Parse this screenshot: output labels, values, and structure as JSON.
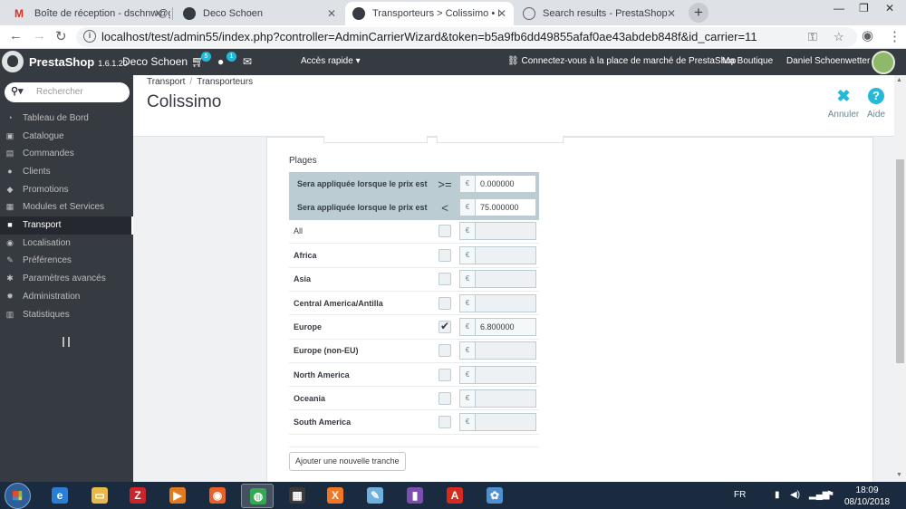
{
  "browser": {
    "tabs": [
      {
        "title": "Boîte de réception - dschnw@gm",
        "favicon_color": "#d93025"
      },
      {
        "title": "Deco Schoen",
        "favicon_color": "#363a41"
      },
      {
        "title": "Transporteurs > Colissimo • Deco",
        "favicon_color": "#363a41"
      },
      {
        "title": "Search results - PrestaShop",
        "favicon_color": "#5f6368"
      }
    ],
    "new_tab": "+",
    "url": "localhost/test/admin55/index.php?controller=AdminCarrierWizard&token=b5a9fb6dd49855afaf0ae43abdeb848f&id_carrier=11"
  },
  "header": {
    "brand": "PrestaShop",
    "version": "1.6.1.20",
    "shop_name": "Deco Schoen",
    "orders_badge": "5",
    "customers_badge": "1",
    "quick_access": "Accès rapide",
    "marketplace": "Connectez-vous à la place de marché de PrestaShop",
    "my_shop": "Ma Boutique",
    "user": "Daniel Schoenwetter"
  },
  "sidebar": {
    "search_placeholder": "Rechercher",
    "items": [
      {
        "label": "Tableau de Bord",
        "icon": "dashboard-icon",
        "glyph": "◔"
      },
      {
        "label": "Catalogue",
        "icon": "catalog-icon",
        "glyph": "▣"
      },
      {
        "label": "Commandes",
        "icon": "orders-icon",
        "glyph": "▤"
      },
      {
        "label": "Clients",
        "icon": "clients-icon",
        "glyph": "●"
      },
      {
        "label": "Promotions",
        "icon": "promotions-icon",
        "glyph": "◆"
      },
      {
        "label": "Modules et Services",
        "icon": "modules-icon",
        "glyph": "▦"
      },
      {
        "label": "Transport",
        "icon": "truck-icon",
        "glyph": "■"
      },
      {
        "label": "Localisation",
        "icon": "globe-icon",
        "glyph": "◉"
      },
      {
        "label": "Préférences",
        "icon": "wrench-icon",
        "glyph": "✎"
      },
      {
        "label": "Paramètres avancés",
        "icon": "cogs-icon",
        "glyph": "✱"
      },
      {
        "label": "Administration",
        "icon": "gear-icon",
        "glyph": "✹"
      },
      {
        "label": "Statistiques",
        "icon": "bar-chart-icon",
        "glyph": "▥"
      }
    ],
    "active_index": 6
  },
  "page": {
    "breadcrumb": [
      "Transport",
      "Transporteurs"
    ],
    "title": "Colissimo",
    "cancel_label": "Annuler",
    "help_label": "Aide"
  },
  "ranges": {
    "section_label": "Plages",
    "conditions": [
      {
        "label": "Sera appliquée lorsque le prix est",
        "operator": ">=",
        "currency": "€",
        "value": "0.000000"
      },
      {
        "label": "Sera appliquée lorsque le prix est",
        "operator": "<",
        "currency": "€",
        "value": "75.000000"
      }
    ],
    "zones": [
      {
        "name": "All",
        "checked": false,
        "currency": "€",
        "price": ""
      },
      {
        "name": "Africa",
        "checked": false,
        "currency": "€",
        "price": ""
      },
      {
        "name": "Asia",
        "checked": false,
        "currency": "€",
        "price": ""
      },
      {
        "name": "Central America/Antilla",
        "checked": false,
        "currency": "€",
        "price": ""
      },
      {
        "name": "Europe",
        "checked": true,
        "currency": "€",
        "price": "6.800000"
      },
      {
        "name": "Europe (non-EU)",
        "checked": false,
        "currency": "€",
        "price": ""
      },
      {
        "name": "North America",
        "checked": false,
        "currency": "€",
        "price": ""
      },
      {
        "name": "Oceania",
        "checked": false,
        "currency": "€",
        "price": ""
      },
      {
        "name": "South America",
        "checked": false,
        "currency": "€",
        "price": ""
      }
    ],
    "add_button": "Ajouter une nouvelle tranche"
  },
  "taskbar": {
    "language": "FR",
    "time": "18:09",
    "date": "08/10/2018",
    "apps": [
      {
        "icon": "internet-explorer-icon",
        "glyph": "e",
        "color": "#2a7fd4"
      },
      {
        "icon": "file-explorer-icon",
        "glyph": "▭",
        "color": "#e8b84a"
      },
      {
        "icon": "filezilla-icon",
        "glyph": "Z",
        "color": "#c9252b"
      },
      {
        "icon": "media-player-icon",
        "glyph": "▶",
        "color": "#e07b22"
      },
      {
        "icon": "firefox-icon",
        "glyph": "◉",
        "color": "#e8602c"
      },
      {
        "icon": "chrome-icon",
        "glyph": "◍",
        "color": "#35a853"
      },
      {
        "icon": "calculator-icon",
        "glyph": "▦",
        "color": "#3a3a3a"
      },
      {
        "icon": "xampp-icon",
        "glyph": "X",
        "color": "#f37623"
      },
      {
        "icon": "notepad-icon",
        "glyph": "✎",
        "color": "#6fb0de"
      },
      {
        "icon": "book-app-icon",
        "glyph": "▮",
        "color": "#7a4fb0"
      },
      {
        "icon": "pdf-reader-icon",
        "glyph": "A",
        "color": "#d42b1e"
      },
      {
        "icon": "paint-icon",
        "glyph": "✿",
        "color": "#4f8fd4"
      }
    ],
    "active_app": 5
  }
}
